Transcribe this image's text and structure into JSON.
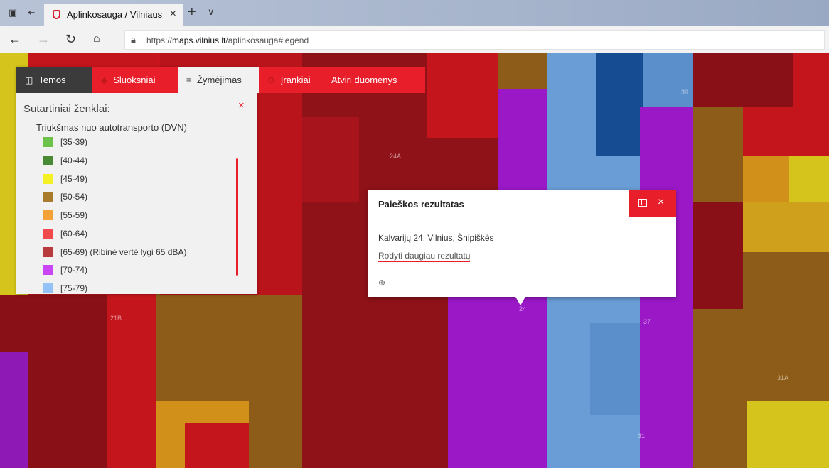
{
  "browser": {
    "tab_title": "Aplinkosauga / Vilniaus",
    "tab_close": "×",
    "new_tab": "+",
    "tab_menu": "∨",
    "url_prefix": "https://",
    "url_host": "maps.vilnius.lt",
    "url_path": "/aplinkosauga#legend"
  },
  "panel": {
    "tabs": [
      {
        "label": "Temos",
        "icon": "layers-icon"
      },
      {
        "label": "Sluoksniai",
        "icon": "stack-icon"
      },
      {
        "label": "Žymėjimas",
        "icon": "menu-icon"
      },
      {
        "label": "Įrankiai",
        "icon": "tools-icon"
      },
      {
        "label": "Atviri duomenys",
        "icon": ""
      }
    ],
    "title": "Sutartiniai ženklai:",
    "close": "×",
    "legend_group": "Triukšmas nuo autotransporto (DVN)",
    "legend": [
      {
        "label": "[35-39)",
        "color": "#6cc24a"
      },
      {
        "label": "[40-44)",
        "color": "#4b8a35"
      },
      {
        "label": "[45-49)",
        "color": "#f4f124"
      },
      {
        "label": "[50-54)",
        "color": "#a87b2c"
      },
      {
        "label": "[55-59)",
        "color": "#f4a235"
      },
      {
        "label": "[60-64)",
        "color": "#f14a4d"
      },
      {
        "label": "[65-69) (Ribinė vertė lygi 65 dBA)",
        "color": "#b83a3c"
      },
      {
        "label": "[70-74)",
        "color": "#c944f2"
      },
      {
        "label": "[75-79)",
        "color": "#94c2f4"
      }
    ]
  },
  "popup": {
    "title": "Paieškos rezultatas",
    "close": "×",
    "address": "Kalvarijų 24, Vilnius, Šnipiškės",
    "more_link": "Rodyti daugiau rezultatų",
    "zoom_icon": "zoom-in-icon"
  },
  "map": {
    "labels": [
      "24A",
      "39",
      "21B",
      "24",
      "37",
      "31A",
      "31"
    ]
  }
}
